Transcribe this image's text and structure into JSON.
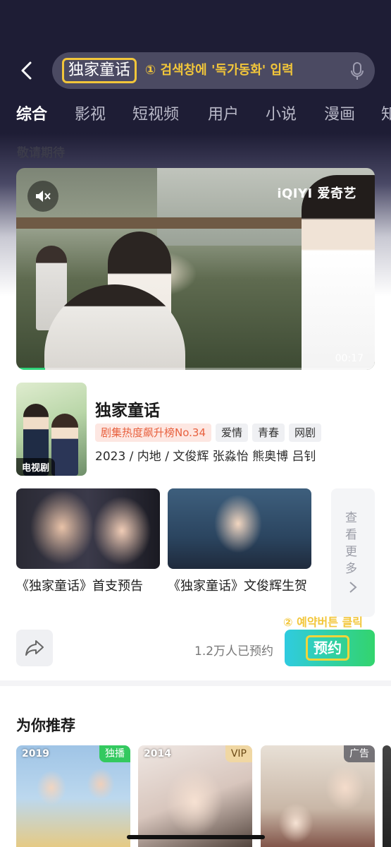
{
  "search": {
    "query": "独家童话",
    "annotation": "① 검색창에 '독가동화' 입력"
  },
  "tabs": [
    "综合",
    "影视",
    "短视频",
    "用户",
    "小说",
    "漫画",
    "知"
  ],
  "section_label": "敬请期待",
  "video": {
    "brand": "iQIYI 爱奇艺",
    "timestamp": "00:17",
    "progress": 0.08
  },
  "show": {
    "poster_badge": "电视剧",
    "title": "独家童话",
    "tags": [
      "剧集热度飙升榜No.34",
      "爱情",
      "青春",
      "网剧"
    ],
    "meta": "2023 / 内地 / 文俊辉 张淼怡 熊奥博 吕钊"
  },
  "clips": [
    {
      "caption": "《独家童话》首支预告"
    },
    {
      "caption": "《独家童话》文俊辉生贺"
    }
  ],
  "more_label": "查看更多",
  "reserve": {
    "count_text": "1.2万人已预约",
    "button_label": "预约",
    "annotation": "② 예약버튼 클릭"
  },
  "recommend": {
    "title": "为你推荐",
    "cards": [
      {
        "year": "2019",
        "badge": "独播"
      },
      {
        "year": "2014",
        "badge": "VIP"
      },
      {
        "year": "",
        "badge": "广告"
      }
    ]
  },
  "colors": {
    "header_bg": "#1e1d35",
    "annotation": "#f2c63a",
    "reserve_gradient_start": "#2fcbe0",
    "reserve_gradient_end": "#33d46d",
    "rank_tag": "#e8613f"
  }
}
